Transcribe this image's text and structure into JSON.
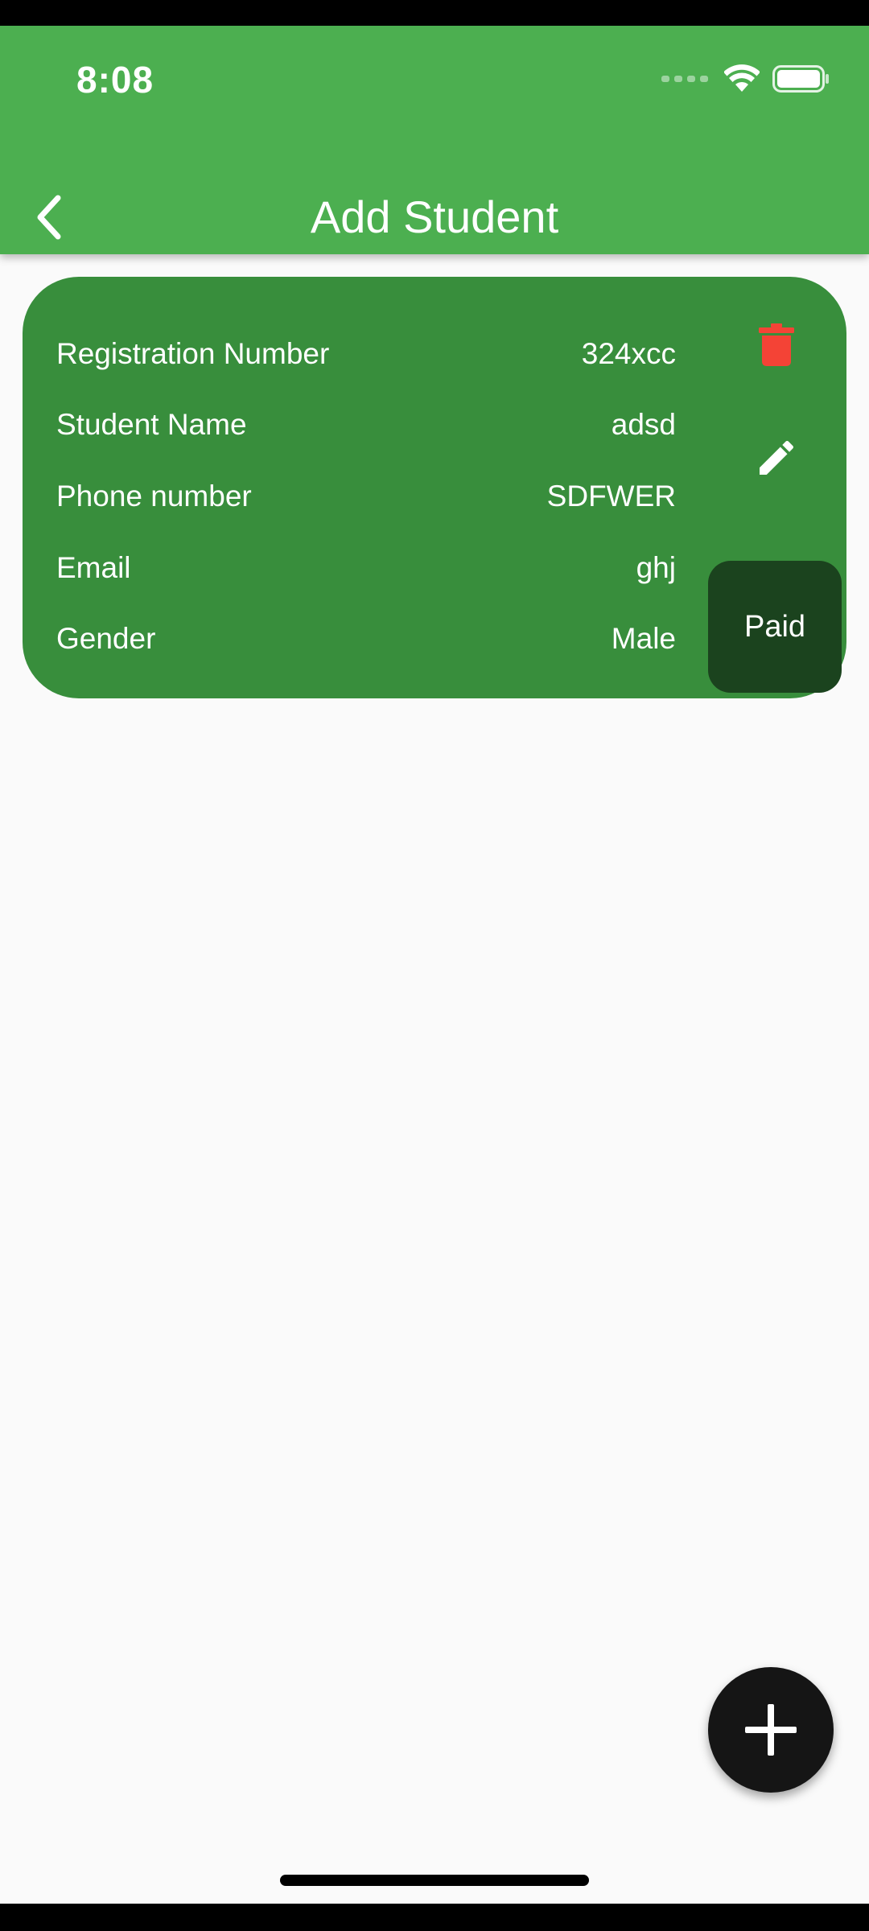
{
  "status_bar": {
    "time": "8:08"
  },
  "app_bar": {
    "title": "Add Student",
    "back_icon": "chevron-left-icon",
    "background": "#4caf50"
  },
  "student_card": {
    "background": "#388e3c",
    "rows": [
      {
        "label": "Registration Number",
        "value": "324xcc"
      },
      {
        "label": "Student Name",
        "value": "adsd"
      },
      {
        "label": "Phone number",
        "value": "SDFWER"
      },
      {
        "label": "Email",
        "value": "ghj"
      },
      {
        "label": "Gender",
        "value": "Male"
      }
    ],
    "actions": {
      "delete_icon": "trash-icon",
      "delete_color": "#f44336",
      "edit_icon": "pencil-icon",
      "paid_label": "Paid",
      "paid_background": "#1b431e"
    }
  },
  "fab": {
    "icon": "plus-icon"
  }
}
